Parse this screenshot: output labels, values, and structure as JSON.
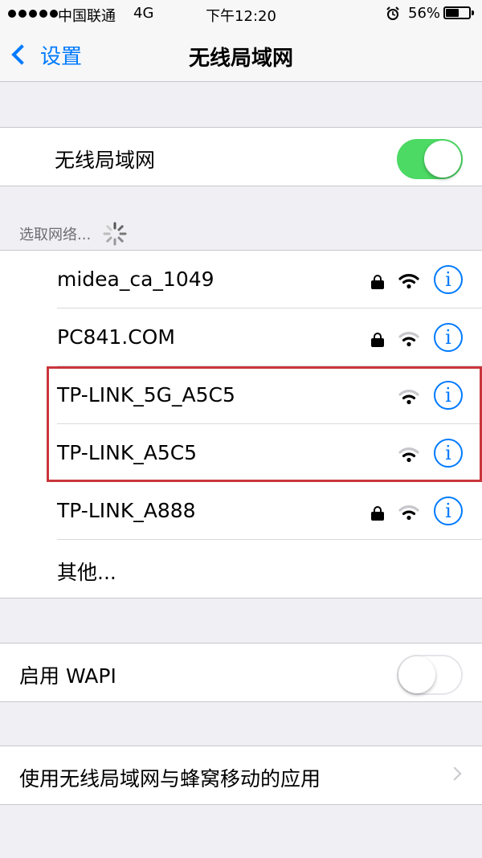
{
  "status_bar": {
    "carrier": "中国联通",
    "network": "4G",
    "time": "下午12:20",
    "battery": "56%",
    "battery_level": 0.56
  },
  "nav": {
    "back_label": "设置",
    "title": "无线局域网"
  },
  "wifi_toggle": {
    "label": "无线局域网",
    "on": true
  },
  "networks_header": "选取网络...",
  "networks": [
    {
      "name": "midea_ca_1049",
      "locked": true,
      "strength": 3
    },
    {
      "name": "PC841.COM",
      "locked": true,
      "strength": 2
    },
    {
      "name": "TP-LINK_5G_A5C5",
      "locked": false,
      "strength": 2
    },
    {
      "name": "TP-LINK_A5C5",
      "locked": false,
      "strength": 2
    },
    {
      "name": "TP-LINK_A888",
      "locked": true,
      "strength": 2
    }
  ],
  "other_label": "其他...",
  "wapi": {
    "label": "启用 WAPI",
    "on": false
  },
  "apps_label": "使用无线局域网与蜂窝移动的应用",
  "colors": {
    "accent": "#007aff",
    "toggle_on": "#4cd964",
    "highlight": "#c9363c"
  }
}
